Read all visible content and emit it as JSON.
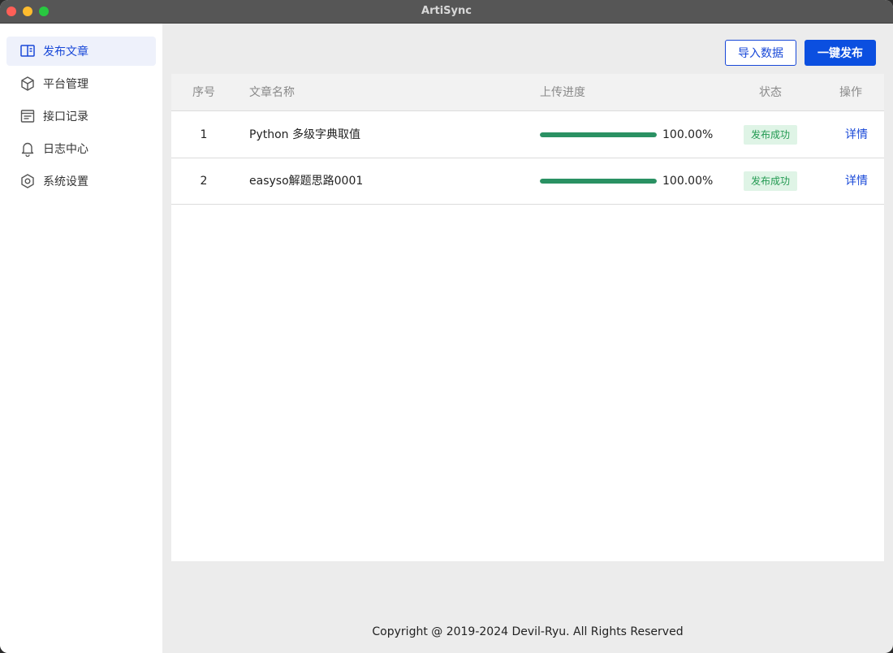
{
  "window": {
    "title": "ArtiSync"
  },
  "sidebar": {
    "items": [
      {
        "label": "发布文章",
        "icon": "book-open-icon",
        "active": true
      },
      {
        "label": "平台管理",
        "icon": "cube-icon",
        "active": false
      },
      {
        "label": "接口记录",
        "icon": "list-document-icon",
        "active": false
      },
      {
        "label": "日志中心",
        "icon": "bell-icon",
        "active": false
      },
      {
        "label": "系统设置",
        "icon": "gear-hexagon-icon",
        "active": false
      }
    ]
  },
  "toolbar": {
    "import_label": "导入数据",
    "publish_label": "一键发布"
  },
  "table": {
    "columns": [
      "序号",
      "文章名称",
      "上传进度",
      "状态",
      "操作"
    ],
    "rows": [
      {
        "index": "1",
        "name": "Python 多级字典取值",
        "progress": 100,
        "progress_label": "100.00%",
        "status": "发布成功",
        "action": "详情"
      },
      {
        "index": "2",
        "name": "easyso解题思路0001",
        "progress": 100,
        "progress_label": "100.00%",
        "status": "发布成功",
        "action": "详情"
      }
    ]
  },
  "footer": {
    "copyright": "Copyright @ 2019-2024 Devil-Ryu. All Rights Reserved"
  },
  "colors": {
    "accent": "#1848d8",
    "primary_button": "#0b4fe0",
    "progress": "#2a9163",
    "success_text": "#239a52",
    "success_bg": "#dff4e6"
  }
}
